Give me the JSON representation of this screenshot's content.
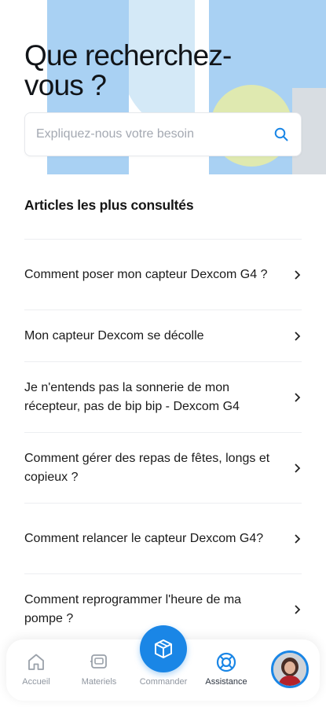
{
  "colors": {
    "accent": "#1a86e6",
    "hero_blue": "#a9d1f3",
    "hero_light": "#d4e9f7",
    "hero_yellow": "#dfe9b0"
  },
  "header": {
    "title": "Que recherchez-vous ?"
  },
  "search": {
    "placeholder": "Expliquez-nous votre besoin",
    "icon": "search-icon"
  },
  "section": {
    "title": "Articles les plus consultés"
  },
  "articles": [
    {
      "label": "Comment poser mon capteur Dexcom G4 ?"
    },
    {
      "label": "Mon capteur Dexcom se décolle"
    },
    {
      "label": "Je n'entends pas la sonnerie de mon récepteur, pas de bip bip - Dexcom G4"
    },
    {
      "label": "Comment gérer des repas de fêtes, longs et copieux ?"
    },
    {
      "label": "Comment relancer le capteur Dexcom G4?"
    },
    {
      "label": "Comment reprogrammer l'heure de ma pompe ?"
    }
  ],
  "tabbar": {
    "home": {
      "label": "Accueil",
      "icon": "home-icon"
    },
    "equipment": {
      "label": "Materiels",
      "icon": "device-icon"
    },
    "order": {
      "label": "Commander",
      "icon": "box-icon"
    },
    "assistance": {
      "label": "Assistance",
      "icon": "lifebuoy-icon"
    },
    "profile": {
      "icon": "avatar"
    }
  }
}
